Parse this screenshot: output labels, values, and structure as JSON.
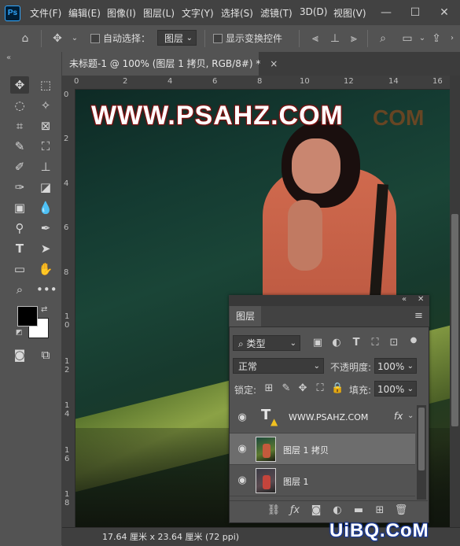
{
  "app": {
    "logo": "Ps"
  },
  "menu": [
    "文件(F)",
    "编辑(E)",
    "图像(I)",
    "图层(L)",
    "文字(Y)",
    "选择(S)",
    "滤镜(T)",
    "3D(D)",
    "视图(V)"
  ],
  "window_controls": {
    "minimize": "—",
    "maximize": "☐",
    "close": "✕"
  },
  "options_bar": {
    "auto_select_label": "自动选择：",
    "auto_select_value": "图层",
    "show_transform_label": "显示变换控件"
  },
  "document": {
    "tab_title": "未标题-1 @ 100% (图层 1 拷贝, RGB/8#) *",
    "tab_close": "×",
    "status": "17.64 厘米 x 23.64 厘米 (72 ppi)"
  },
  "rulers": {
    "top": [
      "0",
      "2",
      "4",
      "6",
      "8",
      "10",
      "12",
      "14",
      "16"
    ],
    "left": [
      "0",
      "2",
      "4",
      "6",
      "8",
      "1\n0",
      "1\n2",
      "1\n4",
      "1\n6",
      "1\n8"
    ]
  },
  "canvas": {
    "watermark": "WWW.PSAHZ.COM",
    "watermark_ghost": "COM"
  },
  "layers_panel": {
    "title": "图层",
    "filter_kind": "类型",
    "blend_mode": "正常",
    "opacity_label": "不透明度:",
    "opacity_value": "100%",
    "lock_label": "锁定:",
    "fill_label": "填充:",
    "fill_value": "100%",
    "layers": [
      {
        "name": "WWW.PSAHZ.COM",
        "type": "text",
        "fx": "fx",
        "selected": false
      },
      {
        "name": "图层 1 拷贝",
        "type": "image",
        "selected": true
      },
      {
        "name": "图层 1",
        "type": "image",
        "selected": false
      }
    ]
  },
  "site_mark": "UiBQ.CoM",
  "colors": {
    "foreground": "#000000",
    "background": "#ffffff",
    "panel": "#535353",
    "menubar": "#424242"
  }
}
